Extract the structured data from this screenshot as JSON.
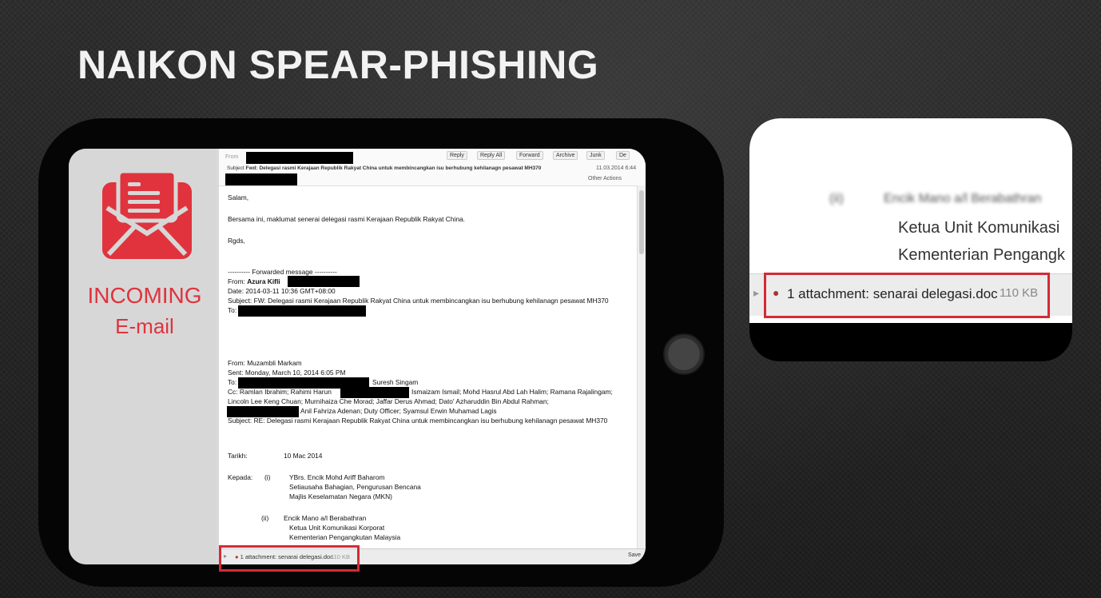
{
  "slide": {
    "title": "NAIKON SPEAR-PHISHING"
  },
  "left_panel": {
    "line1": "INCOMING",
    "line2": "E-mail"
  },
  "colors": {
    "accent_red": "#e0333d",
    "highlight_red": "#d42b36"
  },
  "email": {
    "header": {
      "from_label": "From",
      "subject_label": "Subject",
      "subject": "Fwd: Delegasi rasmi Kerajaan Republik Rakyat China untuk membincangkan isu berhubung kehilanagn pesawat MH370",
      "date": "11.03.2014 6:44",
      "toolbar": [
        "Reply",
        "Reply All",
        "Forward",
        "Archive",
        "Junk",
        "De"
      ],
      "other_actions": "Other Actions"
    },
    "body": {
      "greeting": "Salam,",
      "line1": "Bersama ini, maklumat senerai delegasi rasmi Kerajaan Republik Rakyat China.",
      "regards": "Rgds,",
      "forwarded_header": "---------- Forwarded message ----------",
      "fwd_from_label": "From:",
      "fwd_from_name": "Azura Kifli",
      "fwd_date": "Date: 2014-03-11 10:36 GMT+08:00",
      "fwd_subject": "Subject: FW: Delegasi rasmi Kerajaan Republik Rakyat China untuk membincangkan isu berhubung kehilanagn pesawat MH370",
      "fwd_to": "To:",
      "from2": "From: Muzambli Markam",
      "sent2": "Sent: Monday, March 10, 2014 6:05 PM",
      "to2_label": "To:",
      "to2_name": "Suresh Singam",
      "cc_a": "Cc: Ramlan Ibrahim; Rahimi Harun",
      "cc_b": "Ismaizam Ismail; Mohd Hasrul Abd Lah Halim; Ramana Rajalingam;",
      "cc_line2": "Lincoln Lee Keng Chuan; Murnihaiza Che Morad; Jaffar Derus Ahmad; Dato' Azharuddin Bin Abdul Rahman;",
      "cc_line3": "Anil Fahriza Adenan; Duty Officer; Syamsul Erwin Muhamad Lagis",
      "subject2": "Subject: RE: Delegasi rasmi Kerajaan Republik Rakyat China untuk membincangkan isu berhubung kehilanagn pesawat MH370",
      "tarikh_label": "Tarikh:",
      "tarikh_value": "10 Mac 2014",
      "kepada_label": "Kepada:",
      "item_i": "(i)",
      "i_name": "YBrs. Encik Mohd Ariff Baharom",
      "i_role": "Setiausaha Bahagian, Pengurusan Bencana",
      "i_org": "Majlis Keselamatan Negara (MKN)",
      "item_ii": "(ii)",
      "ii_name": "Encik Mano a/l Berabathran",
      "ii_role": "Ketua Unit Komunikasi Korporat",
      "ii_org": "Kementerian Pengangkutan Malaysia"
    },
    "attachment": {
      "label": "1 attachment:",
      "filename": "senarai delegasi.doc",
      "size": "110 KB",
      "save": "Save"
    }
  },
  "zoom": {
    "blur_name": "Encik Mano a/l Berabathran",
    "blur_item": "(ii)",
    "line1": "Ketua Unit Komunikasi",
    "line2": "Kementerian Pengangk",
    "attach_text": "1 attachment: senarai delegasi.doc",
    "attach_size": "110 KB"
  }
}
